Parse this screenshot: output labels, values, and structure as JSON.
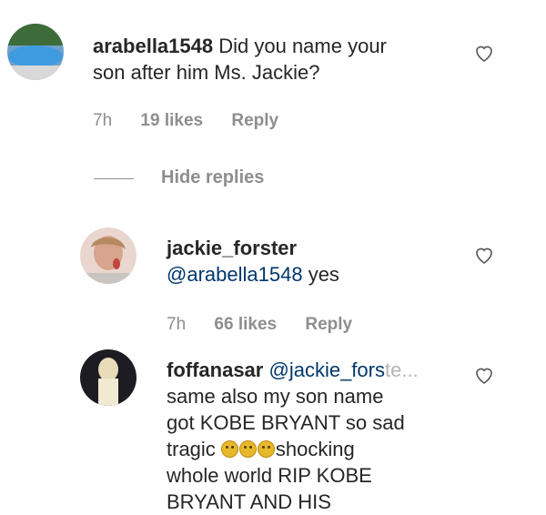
{
  "comments": [
    {
      "username": "arabella1548",
      "text_line1": "Did you name your",
      "text_line2": "son after him Ms. Jackie?",
      "time": "7h",
      "likes": "19 likes",
      "reply": "Reply"
    }
  ],
  "hide_replies": "Hide replies",
  "replies": [
    {
      "username": "jackie_forster",
      "mention": "@arabella1548",
      "text": "yes",
      "time": "7h",
      "likes": "66 likes",
      "reply": "Reply"
    },
    {
      "username": "foffanasar",
      "mention": "@jackie_fors",
      "mention_faded": "te...",
      "line1": "same also my son name",
      "line2": "got KOBE BRYANT so sad",
      "line3_pre": "tragic",
      "line3_post": "shocking",
      "line4": "whole world RIP KOBE",
      "line5": "BRYANT AND HIS"
    }
  ],
  "icons": {
    "like": "heart-outline-icon",
    "emoji": "worried-face-emoji"
  },
  "colors": {
    "username": "#262626",
    "mention": "#00376b",
    "meta": "#8e8e8e"
  }
}
